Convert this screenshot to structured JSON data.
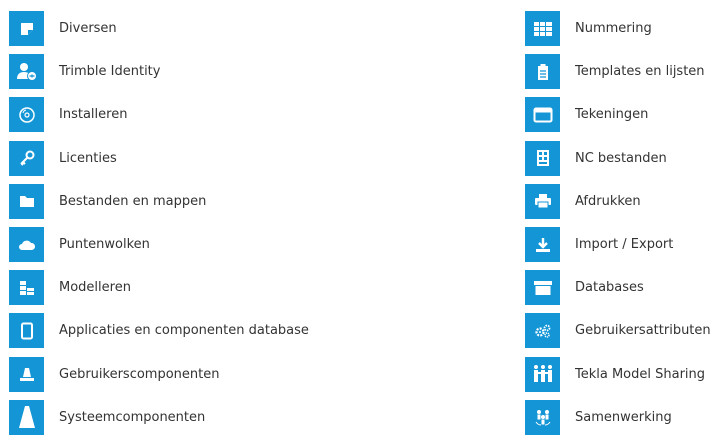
{
  "colors": {
    "tile": "#1496d6",
    "icon": "#ffffff",
    "text": "#333333"
  },
  "left_items": [
    {
      "label": "Diversen",
      "icon": "sticky-note-icon"
    },
    {
      "label": "Trimble Identity",
      "icon": "user-identity-icon"
    },
    {
      "label": "Installeren",
      "icon": "disc-icon"
    },
    {
      "label": "Licenties",
      "icon": "key-icon"
    },
    {
      "label": "Bestanden en mappen",
      "icon": "folder-icon"
    },
    {
      "label": "Puntenwolken",
      "icon": "cloud-icon"
    },
    {
      "label": "Modelleren",
      "icon": "modeling-blocks-icon"
    },
    {
      "label": "Applicaties en componenten database",
      "icon": "tablet-icon"
    },
    {
      "label": "Gebruikerscomponenten",
      "icon": "user-component-cone-icon"
    },
    {
      "label": "Systeemcomponenten",
      "icon": "system-component-cone-icon"
    }
  ],
  "right_items": [
    {
      "label": "Nummering",
      "icon": "numbering-grid-icon"
    },
    {
      "label": "Templates en lijsten",
      "icon": "clipboard-icon"
    },
    {
      "label": "Tekeningen",
      "icon": "drawing-window-icon"
    },
    {
      "label": "NC bestanden",
      "icon": "nc-file-icon"
    },
    {
      "label": "Afdrukken",
      "icon": "printer-icon"
    },
    {
      "label": "Import / Export",
      "icon": "download-icon"
    },
    {
      "label": "Databases",
      "icon": "database-box-icon"
    },
    {
      "label": "Gebruikersattributen",
      "icon": "gears-icon"
    },
    {
      "label": "Tekla Model Sharing",
      "icon": "people-sharing-icon"
    },
    {
      "label": "Samenwerking",
      "icon": "collaboration-icon"
    }
  ]
}
